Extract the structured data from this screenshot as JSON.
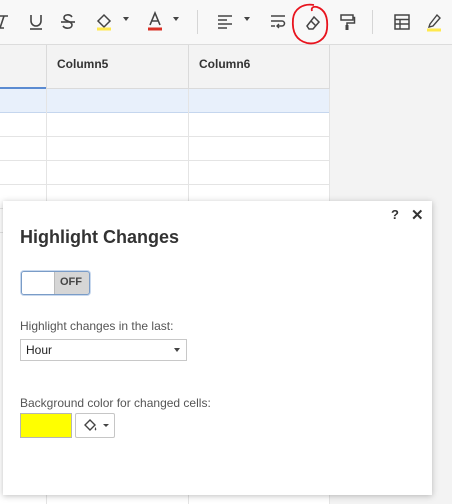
{
  "toolbar": {
    "buttons": [
      "italic-icon",
      "underline-icon",
      "strikethrough-icon",
      "fill-color-icon",
      "text-color-icon",
      "align-icon",
      "wrap-text-icon",
      "clear-formatting-icon",
      "paint-format-icon",
      "table-icon",
      "highlight-icon"
    ],
    "fill_color_accent": "#ffe94d",
    "text_color_accent": "#d93025",
    "annotation_color": "#e8141e"
  },
  "sheet": {
    "columns": [
      "Column5",
      "Column6"
    ],
    "grid_rows": 12
  },
  "dialog": {
    "title": "Highlight Changes",
    "help": "?",
    "close": "✕",
    "toggle_label": "OFF",
    "range_label": "Highlight changes in the last:",
    "range_value": "Hour",
    "color_label": "Background color for changed cells:",
    "color_value": "#ffff00"
  }
}
